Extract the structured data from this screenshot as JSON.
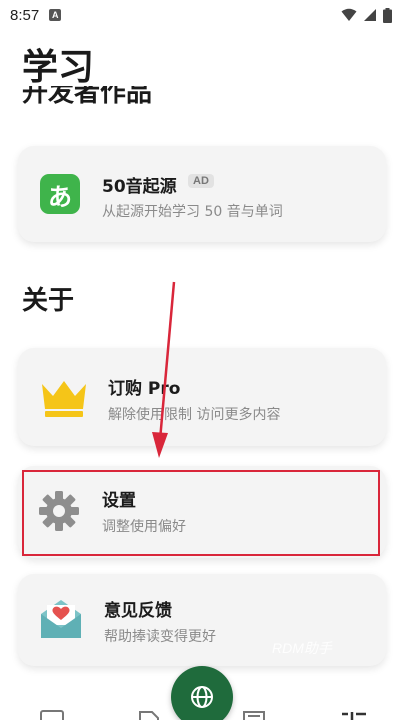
{
  "status_bar": {
    "time": "8:57",
    "notification_glyph": "A",
    "icons": [
      "wifi-icon",
      "signal-icon",
      "battery-icon"
    ]
  },
  "page": {
    "title": "学习",
    "clipped_section_title": "开发者作品"
  },
  "works": {
    "app": {
      "icon_glyph": "あ",
      "title": "50音起源",
      "badge": "AD",
      "subtitle": "从起源开始学习 50 音与单词"
    }
  },
  "about": {
    "section_title": "关于",
    "items": [
      {
        "id": "subscribe",
        "icon": "crown-icon",
        "title": "订购 Pro",
        "subtitle": "解除使用限制 访问更多内容"
      },
      {
        "id": "settings",
        "icon": "gear-icon",
        "title": "设置",
        "subtitle": "调整使用偏好"
      },
      {
        "id": "feedback",
        "icon": "mail-heart-icon",
        "title": "意见反馈",
        "subtitle": "帮助捧读变得更好"
      }
    ]
  },
  "overlay": {
    "watermark": "RDM助手"
  },
  "colors": {
    "app_icon_green": "#3fb44b",
    "crown_gold": "#f5c518",
    "gear_grey": "#8e8e8e",
    "fab_green": "#1f6b3c",
    "annotation_red": "#d9263a"
  }
}
